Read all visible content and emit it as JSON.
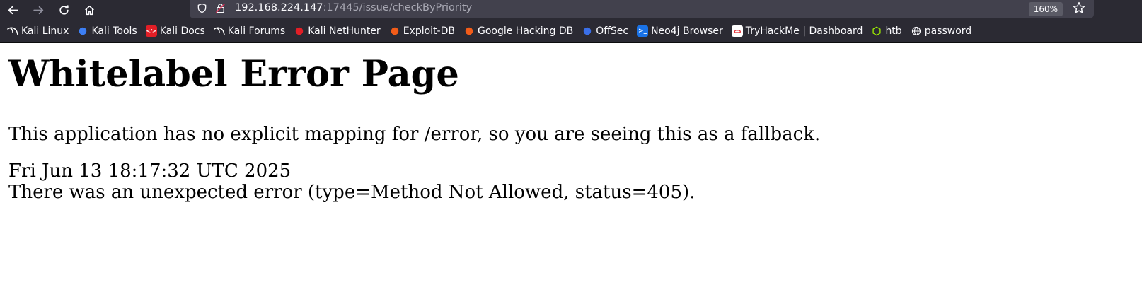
{
  "browser": {
    "url_host": "192.168.224.147",
    "url_rest": ":17445/issue/checkByPriority",
    "zoom": "160%"
  },
  "bookmarks": [
    {
      "label": "Kali Linux",
      "icon": "kali-dragon-icon",
      "color": "#ffffff"
    },
    {
      "label": "Kali Tools",
      "icon": "kali-tools-icon",
      "color": "#3d7ff5"
    },
    {
      "label": "Kali Docs",
      "icon": "kali-docs-icon",
      "color": "#e21e26"
    },
    {
      "label": "Kali Forums",
      "icon": "kali-dragon-icon",
      "color": "#ffffff"
    },
    {
      "label": "Kali NetHunter",
      "icon": "nethunter-icon",
      "color": "#e21e26"
    },
    {
      "label": "Exploit-DB",
      "icon": "exploit-db-icon",
      "color": "#f25c19"
    },
    {
      "label": "Google Hacking DB",
      "icon": "ghdb-icon",
      "color": "#f25c19"
    },
    {
      "label": "OffSec",
      "icon": "offsec-icon",
      "color": "#3a6fe8"
    },
    {
      "label": "Neo4j Browser",
      "icon": "neo4j-icon",
      "color": "#1a73e8"
    },
    {
      "label": "TryHackMe | Dashboard",
      "icon": "tryhackme-icon",
      "color": "#ffffff"
    },
    {
      "label": "htb",
      "icon": "htb-icon",
      "color": "#9fef00"
    },
    {
      "label": "password",
      "icon": "globe-icon",
      "color": "#fbfbfe"
    }
  ],
  "page": {
    "title": "Whitelabel Error Page",
    "fallback": "This application has no explicit mapping for /error, so you are seeing this as a fallback.",
    "timestamp": "Fri Jun 13 18:17:32 UTC 2025",
    "error": "There was an unexpected error (type=Method Not Allowed, status=405)."
  }
}
